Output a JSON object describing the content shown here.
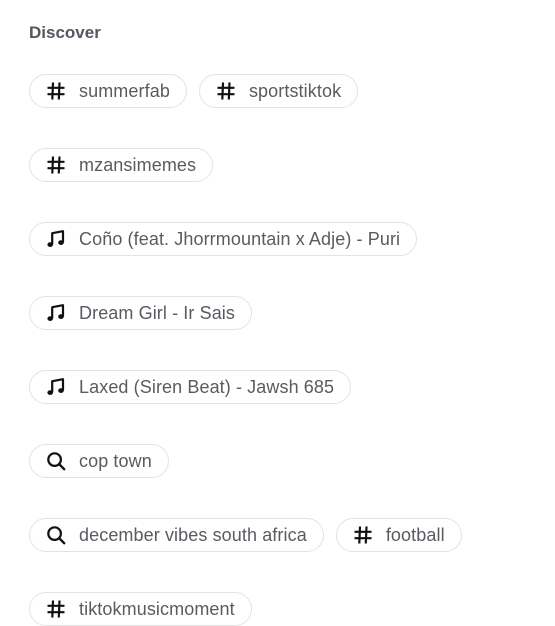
{
  "discover": {
    "title": "Discover",
    "chips": [
      {
        "type": "hashtag",
        "icon": "hashtag-icon",
        "label": "summerfab"
      },
      {
        "type": "hashtag",
        "icon": "hashtag-icon",
        "label": "sportstiktok"
      },
      {
        "type": "hashtag",
        "icon": "hashtag-icon",
        "label": "mzansimemes"
      },
      {
        "type": "music",
        "icon": "music-note-icon",
        "label": "Coño (feat. Jhorrmountain x Adje) - Puri"
      },
      {
        "type": "music",
        "icon": "music-note-icon",
        "label": "Dream Girl - Ir Sais"
      },
      {
        "type": "music",
        "icon": "music-note-icon",
        "label": "Laxed (Siren Beat) - Jawsh 685"
      },
      {
        "type": "search",
        "icon": "search-icon",
        "label": "cop town"
      },
      {
        "type": "search",
        "icon": "search-icon",
        "label": "december vibes south africa"
      },
      {
        "type": "hashtag",
        "icon": "hashtag-icon",
        "label": "football"
      },
      {
        "type": "hashtag",
        "icon": "hashtag-icon",
        "label": "tiktokmusicmoment"
      }
    ]
  }
}
